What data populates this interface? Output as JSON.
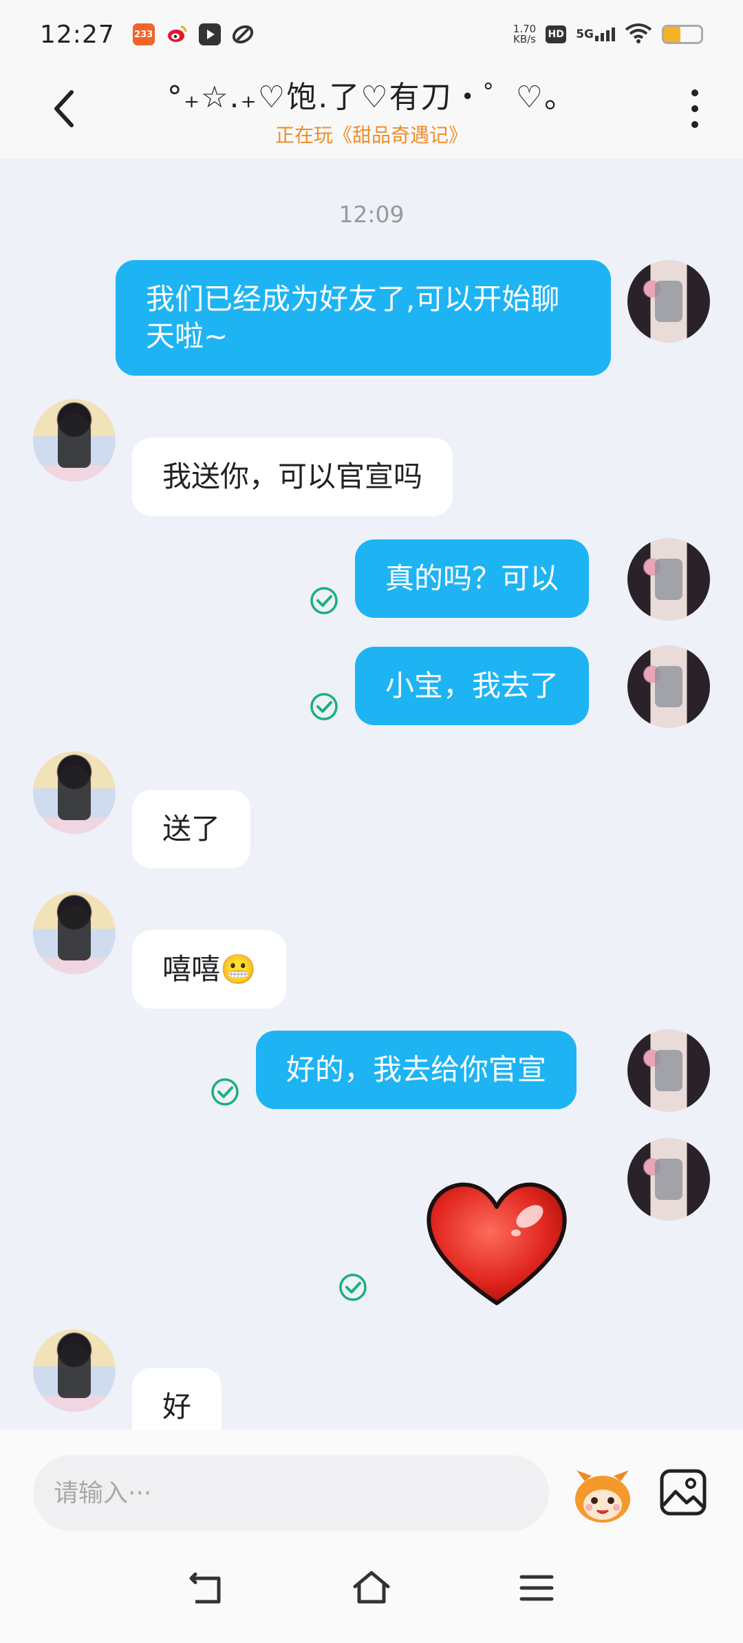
{
  "status_bar": {
    "time": "12:27",
    "app_icons": [
      {
        "name": "233-icon",
        "label": "233",
        "color": "#f0642a"
      },
      {
        "name": "weibo-icon",
        "label": "",
        "color": "#f5a51f"
      },
      {
        "name": "video-icon",
        "label": "",
        "color": "#333333"
      },
      {
        "name": "link-icon",
        "label": "",
        "color": "#333333"
      }
    ],
    "net_speed_value": "1.70",
    "net_speed_unit": "KB/s",
    "hd_label": "HD",
    "network_label": "5G",
    "battery_level": 0.45
  },
  "header": {
    "title": "°₊☆.₊♡饱.了♡有刀・゜♡。",
    "subtitle": "正在玩《甜品奇遇记》"
  },
  "chat": {
    "timestamp": "12:09",
    "messages": [
      {
        "from": "me",
        "text": "我们已经成为好友了,可以开始聊天啦~"
      },
      {
        "from": "other",
        "text": "我送你，可以官宣吗"
      },
      {
        "from": "me",
        "text": "真的吗？可以",
        "read": true
      },
      {
        "from": "me",
        "text": "小宝，我去了",
        "read": true
      },
      {
        "from": "other",
        "text": "送了"
      },
      {
        "from": "other",
        "text": "嘻嘻😬"
      },
      {
        "from": "me",
        "text": "好的，我去给你官宣",
        "read": true
      },
      {
        "from": "me",
        "sticker": "heart-sticker",
        "read": true
      },
      {
        "from": "other",
        "text": "好"
      }
    ]
  },
  "input_bar": {
    "placeholder": "请输入···",
    "value": ""
  },
  "colors": {
    "my_bubble": "#1eb4f3",
    "other_bubble": "#ffffff",
    "read_check": "#1ab07a",
    "subtitle": "#f08c2a",
    "background": "#eef1f8"
  }
}
